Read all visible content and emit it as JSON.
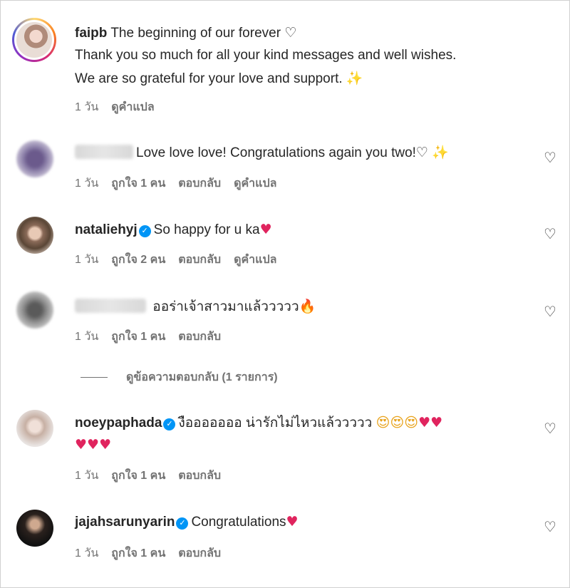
{
  "caption": {
    "username": "faipb",
    "text_line1": "The beginning of our forever",
    "text_line2": "Thank you so much for all your kind messages and well wishes.",
    "text_line3": "We are so grateful for your love and support.",
    "time": "1 วัน",
    "translate": "ดูคำแปล"
  },
  "comments": [
    {
      "username": "",
      "text": "Love love love! Congratulations again you two!",
      "time": "1 วัน",
      "likes": "ถูกใจ 1 คน",
      "reply": "ตอบกลับ",
      "translate": "ดูคำแปล"
    },
    {
      "username": "nataliehyj",
      "text": "So happy for u ka",
      "time": "1 วัน",
      "likes": "ถูกใจ 2 คน",
      "reply": "ตอบกลับ",
      "translate": "ดูคำแปล"
    },
    {
      "username": "",
      "text": "ออร่าเจ้าสาวมาแล้ววววว",
      "time": "1 วัน",
      "likes": "ถูกใจ 1 คน",
      "reply": "ตอบกลับ"
    },
    {
      "username": "noeypaphada",
      "text": "งือออออออ น่ารักไม่ไหวแล้ววววว",
      "time": "1 วัน",
      "likes": "ถูกใจ 1 คน",
      "reply": "ตอบกลับ"
    },
    {
      "username": "jajahsarunyarin",
      "text": "Congratulations",
      "time": "1 วัน",
      "likes": "ถูกใจ 1 คน",
      "reply": "ตอบกลับ"
    }
  ],
  "view_replies": "ดูข้อความตอบกลับ (1 รายการ)",
  "icons": {
    "heart_outline": "heart-outline-icon",
    "heart_red": "red-heart-emoji",
    "sparkles": "sparkles-emoji",
    "fire": "fire-emoji",
    "heart_eyes": "heart-eyes-emoji",
    "verified": "verified-badge-icon"
  }
}
